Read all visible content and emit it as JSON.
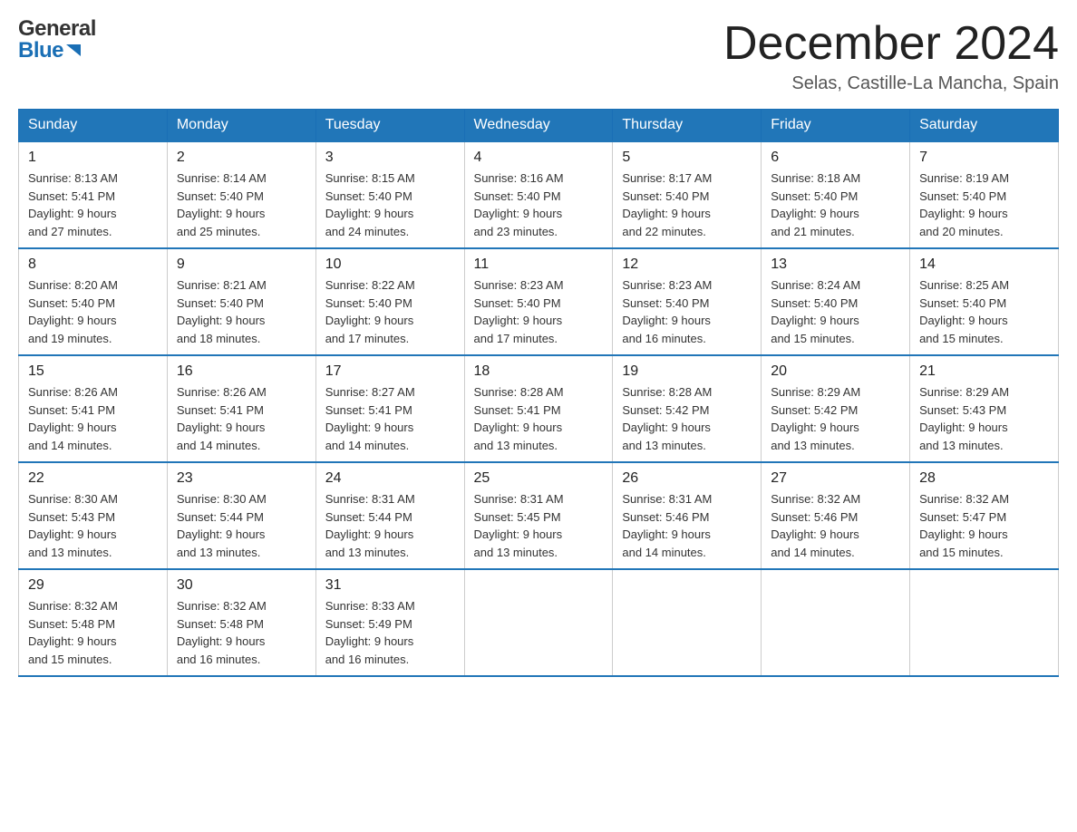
{
  "header": {
    "logo_general": "General",
    "logo_blue": "Blue",
    "month_title": "December 2024",
    "location": "Selas, Castille-La Mancha, Spain"
  },
  "weekdays": [
    "Sunday",
    "Monday",
    "Tuesday",
    "Wednesday",
    "Thursday",
    "Friday",
    "Saturday"
  ],
  "weeks": [
    [
      {
        "day": "1",
        "sunrise": "8:13 AM",
        "sunset": "5:41 PM",
        "daylight": "9 hours and 27 minutes."
      },
      {
        "day": "2",
        "sunrise": "8:14 AM",
        "sunset": "5:40 PM",
        "daylight": "9 hours and 25 minutes."
      },
      {
        "day": "3",
        "sunrise": "8:15 AM",
        "sunset": "5:40 PM",
        "daylight": "9 hours and 24 minutes."
      },
      {
        "day": "4",
        "sunrise": "8:16 AM",
        "sunset": "5:40 PM",
        "daylight": "9 hours and 23 minutes."
      },
      {
        "day": "5",
        "sunrise": "8:17 AM",
        "sunset": "5:40 PM",
        "daylight": "9 hours and 22 minutes."
      },
      {
        "day": "6",
        "sunrise": "8:18 AM",
        "sunset": "5:40 PM",
        "daylight": "9 hours and 21 minutes."
      },
      {
        "day": "7",
        "sunrise": "8:19 AM",
        "sunset": "5:40 PM",
        "daylight": "9 hours and 20 minutes."
      }
    ],
    [
      {
        "day": "8",
        "sunrise": "8:20 AM",
        "sunset": "5:40 PM",
        "daylight": "9 hours and 19 minutes."
      },
      {
        "day": "9",
        "sunrise": "8:21 AM",
        "sunset": "5:40 PM",
        "daylight": "9 hours and 18 minutes."
      },
      {
        "day": "10",
        "sunrise": "8:22 AM",
        "sunset": "5:40 PM",
        "daylight": "9 hours and 17 minutes."
      },
      {
        "day": "11",
        "sunrise": "8:23 AM",
        "sunset": "5:40 PM",
        "daylight": "9 hours and 17 minutes."
      },
      {
        "day": "12",
        "sunrise": "8:23 AM",
        "sunset": "5:40 PM",
        "daylight": "9 hours and 16 minutes."
      },
      {
        "day": "13",
        "sunrise": "8:24 AM",
        "sunset": "5:40 PM",
        "daylight": "9 hours and 15 minutes."
      },
      {
        "day": "14",
        "sunrise": "8:25 AM",
        "sunset": "5:40 PM",
        "daylight": "9 hours and 15 minutes."
      }
    ],
    [
      {
        "day": "15",
        "sunrise": "8:26 AM",
        "sunset": "5:41 PM",
        "daylight": "9 hours and 14 minutes."
      },
      {
        "day": "16",
        "sunrise": "8:26 AM",
        "sunset": "5:41 PM",
        "daylight": "9 hours and 14 minutes."
      },
      {
        "day": "17",
        "sunrise": "8:27 AM",
        "sunset": "5:41 PM",
        "daylight": "9 hours and 14 minutes."
      },
      {
        "day": "18",
        "sunrise": "8:28 AM",
        "sunset": "5:41 PM",
        "daylight": "9 hours and 13 minutes."
      },
      {
        "day": "19",
        "sunrise": "8:28 AM",
        "sunset": "5:42 PM",
        "daylight": "9 hours and 13 minutes."
      },
      {
        "day": "20",
        "sunrise": "8:29 AM",
        "sunset": "5:42 PM",
        "daylight": "9 hours and 13 minutes."
      },
      {
        "day": "21",
        "sunrise": "8:29 AM",
        "sunset": "5:43 PM",
        "daylight": "9 hours and 13 minutes."
      }
    ],
    [
      {
        "day": "22",
        "sunrise": "8:30 AM",
        "sunset": "5:43 PM",
        "daylight": "9 hours and 13 minutes."
      },
      {
        "day": "23",
        "sunrise": "8:30 AM",
        "sunset": "5:44 PM",
        "daylight": "9 hours and 13 minutes."
      },
      {
        "day": "24",
        "sunrise": "8:31 AM",
        "sunset": "5:44 PM",
        "daylight": "9 hours and 13 minutes."
      },
      {
        "day": "25",
        "sunrise": "8:31 AM",
        "sunset": "5:45 PM",
        "daylight": "9 hours and 13 minutes."
      },
      {
        "day": "26",
        "sunrise": "8:31 AM",
        "sunset": "5:46 PM",
        "daylight": "9 hours and 14 minutes."
      },
      {
        "day": "27",
        "sunrise": "8:32 AM",
        "sunset": "5:46 PM",
        "daylight": "9 hours and 14 minutes."
      },
      {
        "day": "28",
        "sunrise": "8:32 AM",
        "sunset": "5:47 PM",
        "daylight": "9 hours and 15 minutes."
      }
    ],
    [
      {
        "day": "29",
        "sunrise": "8:32 AM",
        "sunset": "5:48 PM",
        "daylight": "9 hours and 15 minutes."
      },
      {
        "day": "30",
        "sunrise": "8:32 AM",
        "sunset": "5:48 PM",
        "daylight": "9 hours and 16 minutes."
      },
      {
        "day": "31",
        "sunrise": "8:33 AM",
        "sunset": "5:49 PM",
        "daylight": "9 hours and 16 minutes."
      },
      null,
      null,
      null,
      null
    ]
  ],
  "labels": {
    "sunrise": "Sunrise:",
    "sunset": "Sunset:",
    "daylight": "Daylight:"
  }
}
